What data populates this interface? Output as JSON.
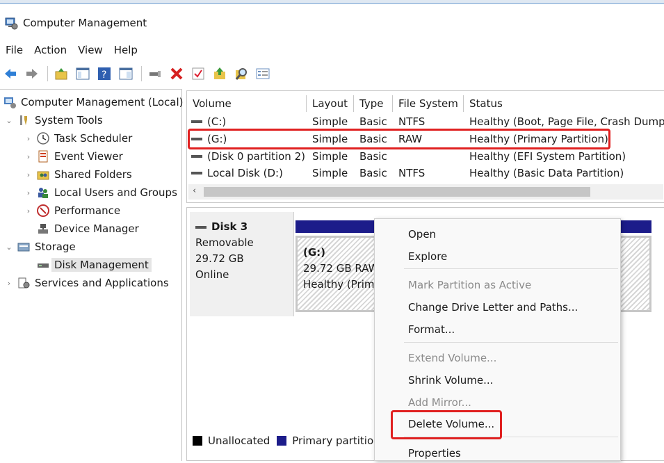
{
  "window": {
    "title": "Computer Management"
  },
  "menu": [
    "File",
    "Action",
    "View",
    "Help"
  ],
  "toolbar": {
    "icons": [
      "back-arrow-icon",
      "forward-arrow-icon",
      "up-folder-icon",
      "show-hide-tree-icon",
      "help-icon",
      "action-pane-icon",
      "connect-icon",
      "delete-icon",
      "check-icon",
      "export-icon",
      "search-icon",
      "properties-icon"
    ]
  },
  "tree": {
    "root": "Computer Management (Local)",
    "system_tools": "System Tools",
    "task_scheduler": "Task Scheduler",
    "event_viewer": "Event Viewer",
    "shared_folders": "Shared Folders",
    "local_users": "Local Users and Groups",
    "performance": "Performance",
    "device_manager": "Device Manager",
    "storage": "Storage",
    "disk_management": "Disk Management",
    "services": "Services and Applications"
  },
  "volumes": {
    "headers": {
      "volume": "Volume",
      "layout": "Layout",
      "type": "Type",
      "fs": "File System",
      "status": "Status"
    },
    "rows": [
      {
        "volume": "(C:)",
        "layout": "Simple",
        "type": "Basic",
        "fs": "NTFS",
        "status": "Healthy (Boot, Page File, Crash Dump"
      },
      {
        "volume": "(G:)",
        "layout": "Simple",
        "type": "Basic",
        "fs": "RAW",
        "status": "Healthy (Primary Partition)"
      },
      {
        "volume": "(Disk 0 partition 2)",
        "layout": "Simple",
        "type": "Basic",
        "fs": "",
        "status": "Healthy (EFI System Partition)"
      },
      {
        "volume": "Local Disk (D:)",
        "layout": "Simple",
        "type": "Basic",
        "fs": "NTFS",
        "status": "Healthy (Basic Data Partition)"
      }
    ]
  },
  "disk": {
    "name": "Disk 3",
    "kind": "Removable",
    "size": "29.72 GB",
    "state": "Online",
    "partition": {
      "letter": "(G:)",
      "size_fs": "29.72 GB RAW",
      "status": "Healthy (Prima"
    }
  },
  "legend": {
    "unallocated": "Unallocated",
    "primary": "Primary partitio"
  },
  "context_menu": {
    "open": "Open",
    "explore": "Explore",
    "mark_active": "Mark Partition as Active",
    "change_letter": "Change Drive Letter and Paths...",
    "format": "Format...",
    "extend": "Extend Volume...",
    "shrink": "Shrink Volume...",
    "add_mirror": "Add Mirror...",
    "delete": "Delete Volume...",
    "properties": "Properties"
  },
  "colors": {
    "primary_partition": "#1c1c8a",
    "unallocated": "#000000",
    "highlight": "#e02020"
  }
}
